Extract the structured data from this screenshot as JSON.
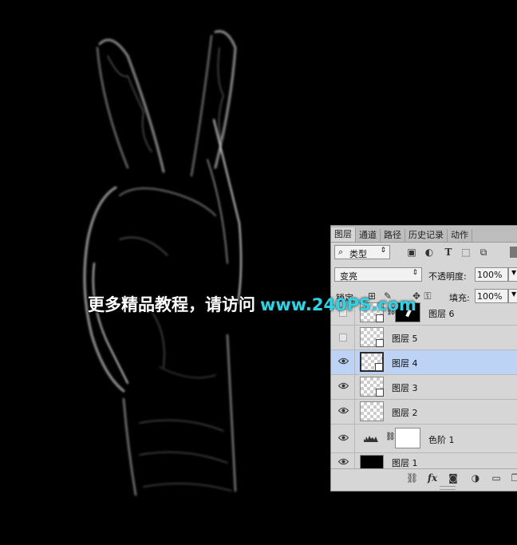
{
  "panel": {
    "tabs": [
      "图层",
      "通道",
      "路径",
      "历史记录",
      "动作"
    ],
    "active_tab": "图层",
    "filter": {
      "kind_label": "类型"
    },
    "blend_mode": "变亮",
    "opacity_label": "不透明度:",
    "opacity_value": "100%",
    "fill_label": "填充:",
    "fill_value": "100%",
    "lock_label": "锁定",
    "layers": [
      {
        "name": "图层 6",
        "visible": false
      },
      {
        "name": "图层 5",
        "visible": false
      },
      {
        "name": "图层 4",
        "visible": true,
        "selected": true
      },
      {
        "name": "图层 3",
        "visible": true
      },
      {
        "name": "图层 2",
        "visible": true
      },
      {
        "name": "色阶 1",
        "visible": true
      },
      {
        "name": "图层 1",
        "visible": true
      }
    ],
    "bottom_icons": [
      "link-icon",
      "fx-icon",
      "mask-icon",
      "adjustment-icon",
      "folder-icon",
      "new-layer-icon"
    ],
    "fx_label": "fx"
  },
  "watermark": {
    "text_cn": "更多精品教程，请访问",
    "text_url": "www.240PS.com"
  },
  "colors": {
    "background": "#000000",
    "selected_layer": "#bcd3f5",
    "watermark_url": "#27d6e8"
  }
}
